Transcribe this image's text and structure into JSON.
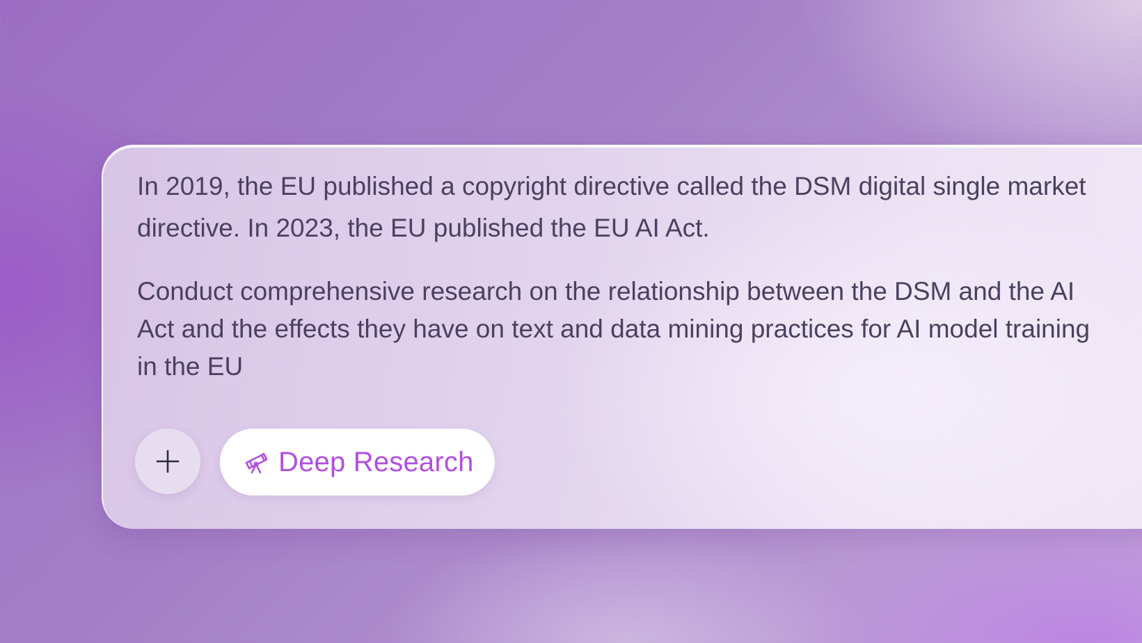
{
  "composer": {
    "prompt_paragraphs": [
      "In 2019, the EU published a copyright directive called the DSM digital single market directive. In 2023, the EU published the EU AI Act.",
      "Conduct comprehensive research on the relationship between the DSM and the AI Act and the effects they have on text and data mining practices for AI model training in the EU"
    ],
    "add_button_icon": "plus-icon",
    "deep_research": {
      "label": "Deep Research",
      "icon": "telescope-icon"
    }
  },
  "colors": {
    "accent": "#b14ee0",
    "text": "#4a4160"
  }
}
